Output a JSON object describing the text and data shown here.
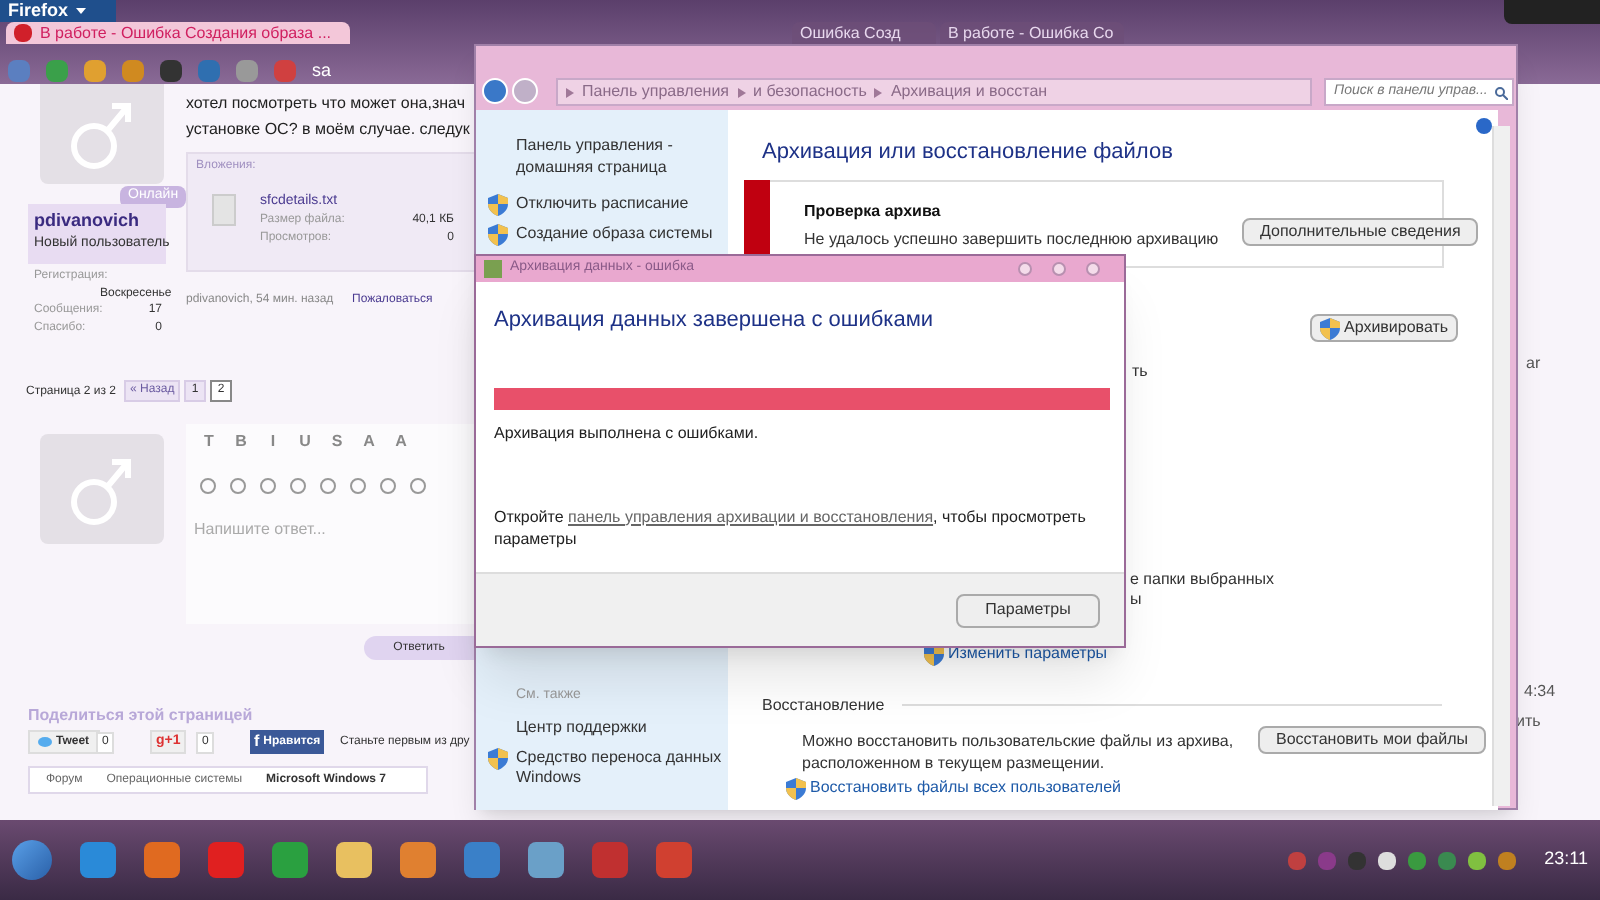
{
  "browser": {
    "menu_button": "Firefox",
    "tabs": [
      {
        "label": "В работе - Ошибка Создания образа ...",
        "selected": true
      },
      {
        "label": "Ошибка Созд",
        "selected": false
      },
      {
        "label": "В работе - Ошибка Со",
        "selected": false
      }
    ],
    "toolbar_text": "sa"
  },
  "forum": {
    "post_lines": [
      "хотел посмотреть что может она,знач",
      "установке ОС? в моём случае. следук"
    ],
    "user": {
      "status": "Онлайн",
      "name": "pdivanovich",
      "rank": "Новый пользователь",
      "stats": [
        {
          "label": "Регистрация:",
          "value": "Воскресенье"
        },
        {
          "label": "Сообщения:",
          "value": "17"
        },
        {
          "label": "Спасибо:",
          "value": "0"
        }
      ]
    },
    "attachment": {
      "heading": "Вложения:",
      "file": "sfcdetails.txt",
      "rows": [
        {
          "label": "Размер файла:",
          "value": "40,1 КБ"
        },
        {
          "label": "Просмотров:",
          "value": "0"
        }
      ]
    },
    "post_meta": {
      "author_time": "pdivanovich, 54 мин. назад",
      "report": "Пожаловаться"
    },
    "pagination": {
      "label": "Страница 2 из 2",
      "prev": "« Назад",
      "pages": [
        {
          "label": "1",
          "selected": false
        },
        {
          "label": "2",
          "selected": true
        }
      ]
    },
    "editor_buttons": [
      "T",
      "B",
      "I",
      "U",
      "S",
      "A",
      "A"
    ],
    "reply": {
      "placeholder": "Напишите ответ...",
      "submit": "Ответить"
    },
    "share": {
      "heading": "Поделиться этой страницей",
      "tweet": "Tweet",
      "tweet_count": "0",
      "gplus": "g+1",
      "gplus_count": "0",
      "like_icon": "f",
      "like": "Нравится",
      "like_text": "Станьте первым из дру"
    },
    "breadcrumbs": [
      {
        "label": "Форум",
        "selected": false
      },
      {
        "label": "Операционные системы",
        "selected": false
      },
      {
        "label": "Microsoft Windows 7",
        "selected": true
      }
    ]
  },
  "control_panel": {
    "address": [
      "Панель управления",
      "и безопасность",
      "Архивация и восстан"
    ],
    "search_placeholder": "Поиск в панели управ...",
    "sidebar": {
      "home": "Панель управления - домашняя страница",
      "tasks": [
        "Отключить расписание",
        "Создание образа системы"
      ],
      "see_also": "См. также",
      "links": [
        {
          "label": "Центр поддержки",
          "kind": "plain"
        },
        {
          "label": "Средство переноса данных Windows",
          "kind": "shield"
        }
      ]
    },
    "title": "Архивация или восстановление файлов",
    "alert": {
      "title": "Проверка архива",
      "message": "Не удалось успешно завершить последнюю архивацию",
      "button": "Дополнительные сведения"
    },
    "backup_button": "Архивировать",
    "covered_fragments": [
      "ть",
      "е папки выбранных",
      "ы"
    ],
    "change_settings": "Изменить параметры",
    "restore": {
      "heading": "Восстановление",
      "text": "Можно восстановить пользовательские файлы из архива, расположенном в текущем размещении.",
      "button": "Восстановить мои файлы",
      "link": "Восстановить файлы всех пользователей"
    }
  },
  "dialog": {
    "title": "Архивация данных - ошибка",
    "heading": "Архивация данных завершена с ошибками",
    "progress": {
      "level": 1
    },
    "status": "Архивация выполнена с ошибками.",
    "message_before": "Откройте ",
    "message_link": "панель управления архивации и восстановления",
    "message_after": ", чтобы просмотреть параметры",
    "button": "Параметры"
  },
  "background_fragments": [
    "ar",
    "4:34",
    "ить"
  ],
  "taskbar": {
    "clock": "23:11"
  }
}
